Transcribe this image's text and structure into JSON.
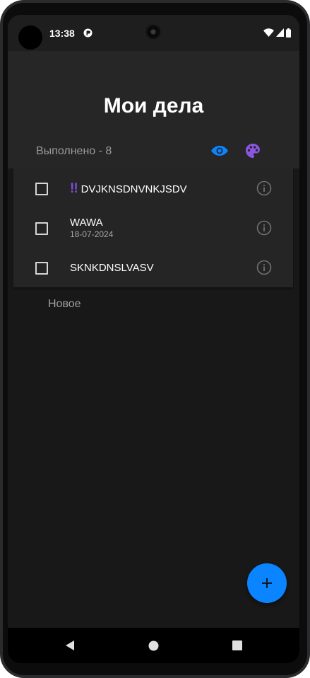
{
  "status_bar": {
    "time": "13:38",
    "notification_icon": "app-notification-icon",
    "wifi_icon": "wifi-icon",
    "signal_icon": "cell-signal-icon",
    "battery_icon": "battery-icon"
  },
  "header": {
    "title": "Мои дела",
    "done_label": "Выполнено - 8",
    "visibility_icon": "eye-icon",
    "theme_icon": "palette-icon"
  },
  "tasks": [
    {
      "title": "DVJKNSDNVNKJSDV",
      "priority_mark": "!!",
      "date": "",
      "checked": false
    },
    {
      "title": "WAWA",
      "priority_mark": "",
      "date": "18-07-2024",
      "checked": false
    },
    {
      "title": "SKNKDNSLVASV",
      "priority_mark": "",
      "date": "",
      "checked": false
    }
  ],
  "new_task_label": "Новое",
  "fab": {
    "icon": "plus-icon",
    "symbol": "+"
  },
  "nav": {
    "back_icon": "back-icon",
    "home_icon": "home-icon",
    "recents_icon": "recents-icon"
  },
  "colors": {
    "accent": "#0a84ff",
    "priority": "#7b4fd6",
    "background": "#181818",
    "surface": "#252525",
    "header": "#262626"
  }
}
